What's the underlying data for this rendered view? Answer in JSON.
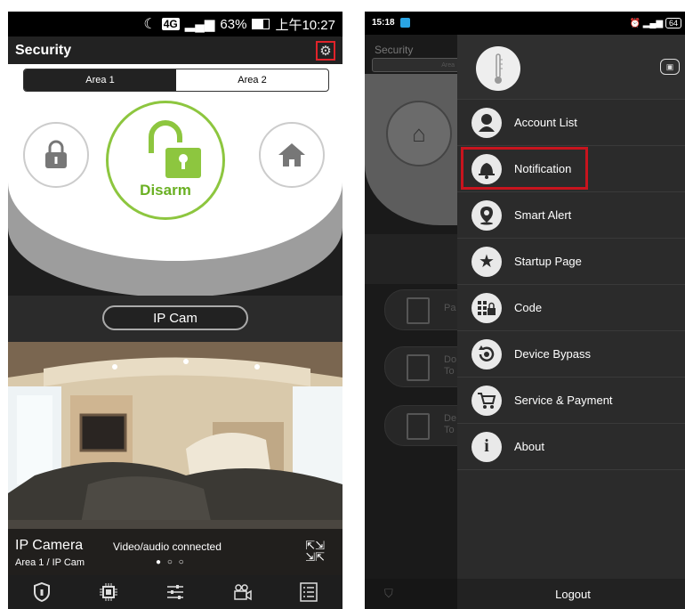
{
  "left": {
    "status": {
      "net": "4G",
      "battery": "63%",
      "time": "上午10:27"
    },
    "header": {
      "title": "Security"
    },
    "area_tabs": [
      "Area 1",
      "Area 2"
    ],
    "disarm_label": "Disarm",
    "ipcam_button": "IP Cam",
    "camera": {
      "title": "IP Camera",
      "status": "Video/audio connected",
      "subtitle": "Area 1 / IP Cam",
      "pager": "● ○ ○"
    },
    "nav_icons": [
      "shield-icon",
      "chip-icon",
      "sliders-icon",
      "camera-icon",
      "list-icon"
    ]
  },
  "right": {
    "status": {
      "time": "15:18",
      "battery": "64"
    },
    "bg": {
      "title": "Security",
      "toggle": "Area",
      "pills": [
        "Pa",
        "Do\nTo",
        "De\nTo"
      ]
    },
    "menu": [
      {
        "label": "Account List",
        "icon": "person-icon"
      },
      {
        "label": "Notification",
        "icon": "bell-icon"
      },
      {
        "label": "Smart Alert",
        "icon": "location-icon"
      },
      {
        "label": "Startup Page",
        "icon": "star-icon"
      },
      {
        "label": "Code",
        "icon": "keypad-lock-icon"
      },
      {
        "label": "Device Bypass",
        "icon": "bypass-icon"
      },
      {
        "label": "Service & Payment",
        "icon": "cart-icon"
      },
      {
        "label": "About",
        "icon": "info-icon"
      }
    ],
    "logout": "Logout"
  },
  "colors": {
    "accent_green": "#8dc63f",
    "highlight_red": "#c8141e"
  }
}
